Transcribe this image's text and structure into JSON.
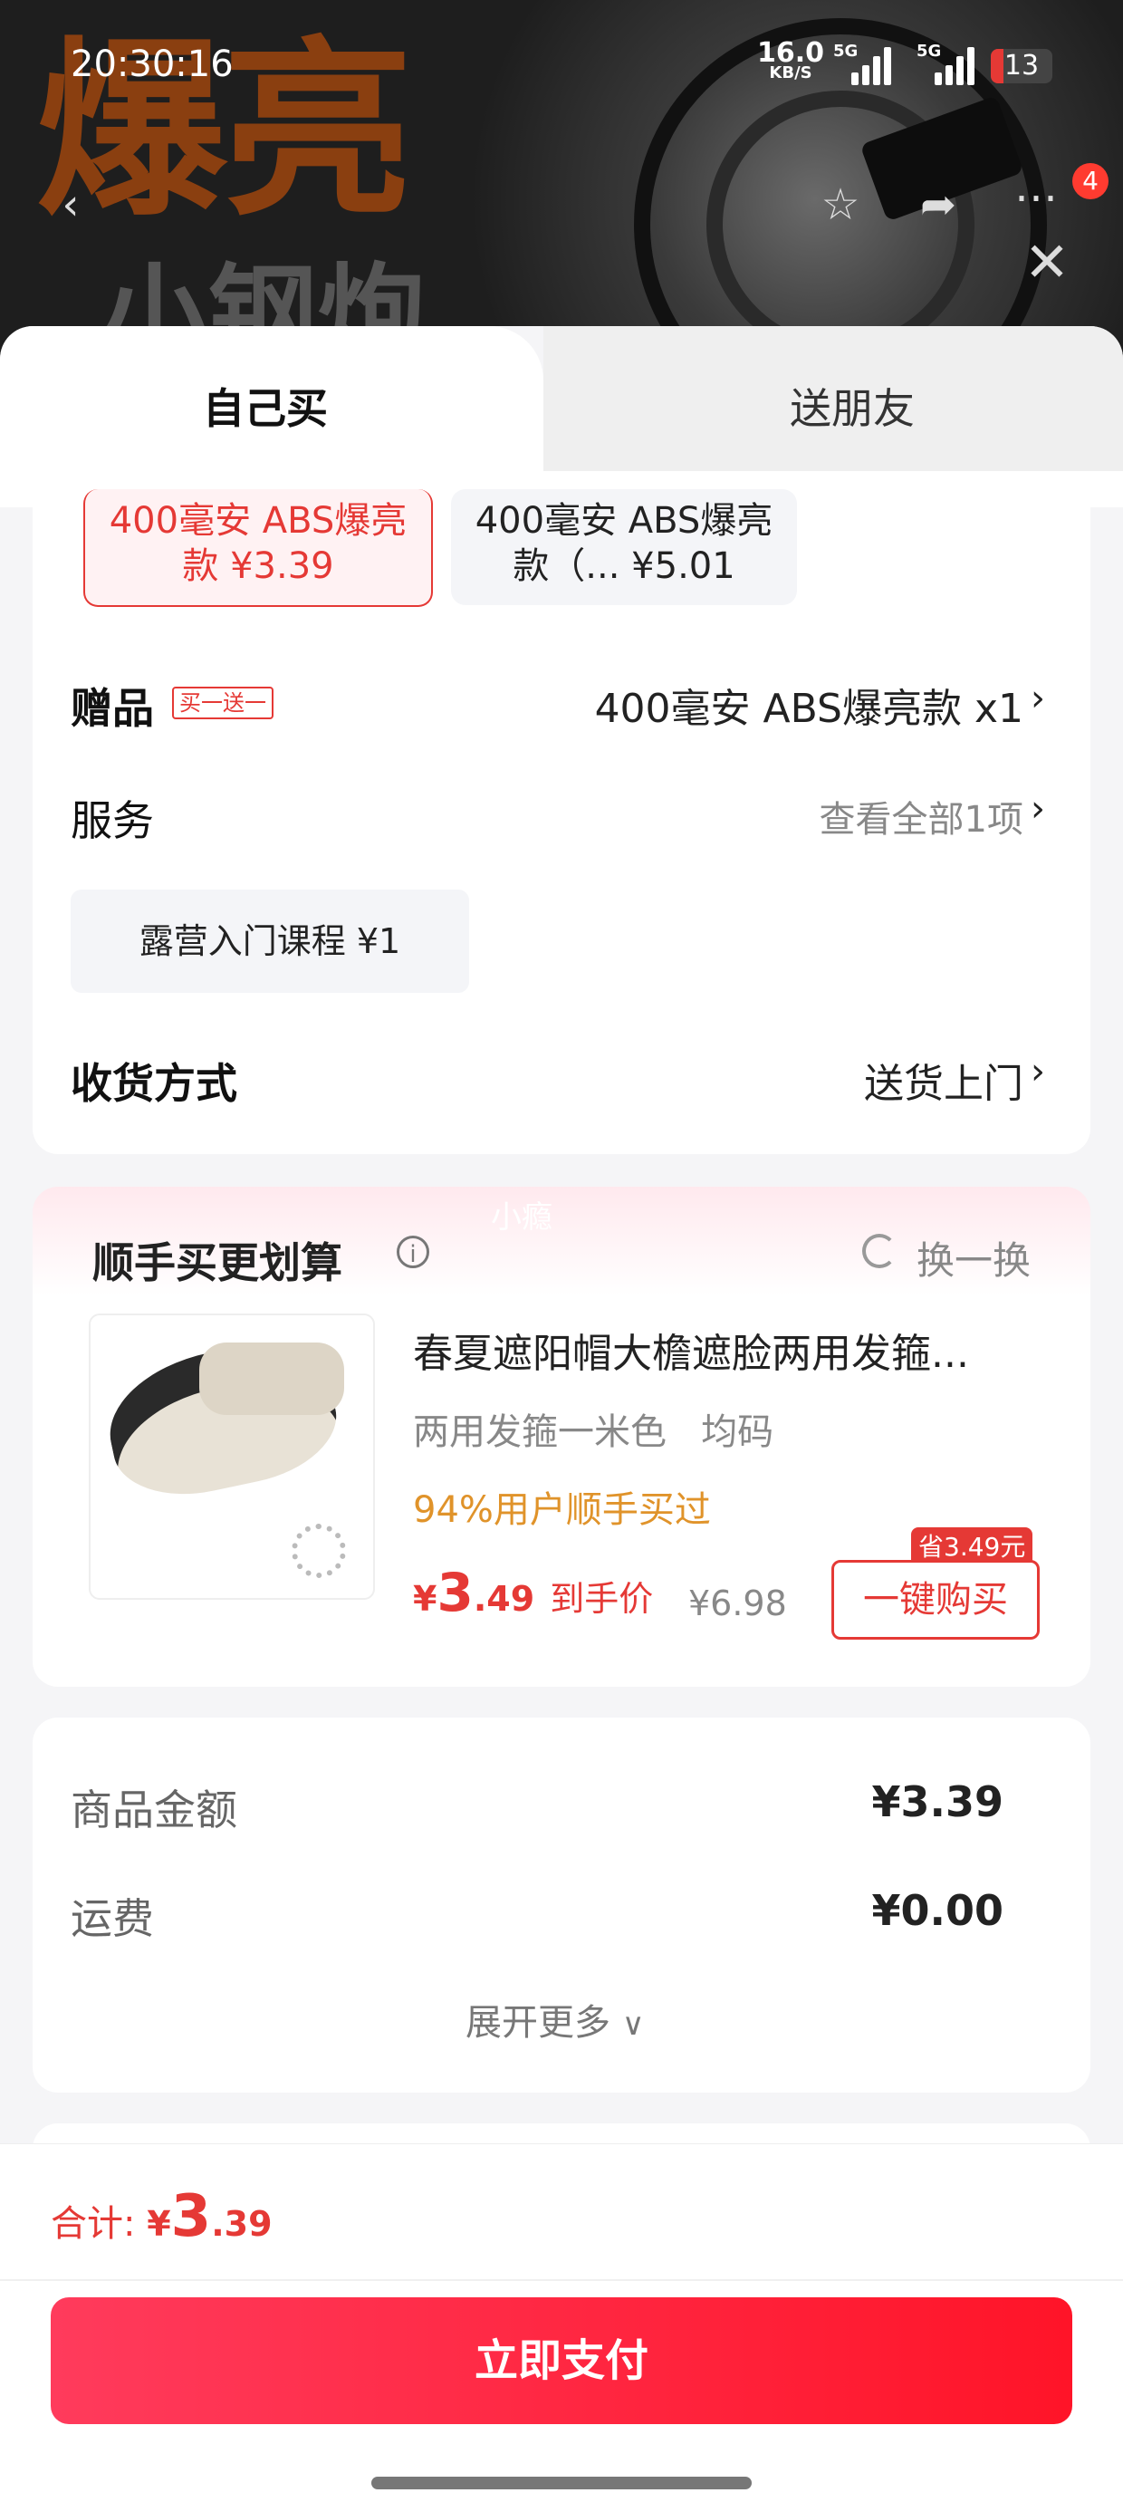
{
  "status_bar": {
    "time": "20:30:16",
    "net_speed_value": "16.0",
    "net_speed_unit": "KB/S",
    "signal1_label": "5G",
    "signal2_label": "5G",
    "battery": "13"
  },
  "header_bg": {
    "headline": "爆亮",
    "subline": "小钢炮",
    "cart_badge": "4"
  },
  "tabs": {
    "self_buy": "自己买",
    "gift_friend": "送朋友"
  },
  "options": [
    {
      "line1": "400毫安 ABS爆亮",
      "line2": "款 ¥3.39",
      "selected": true
    },
    {
      "line1": "400毫安 ABS爆亮",
      "line2": "款（... ¥5.01",
      "selected": false
    }
  ],
  "gift": {
    "label": "赠品",
    "tag": "买一送一",
    "value": "400毫安 ABS爆亮款 x1"
  },
  "service": {
    "label": "服务",
    "value": "查看全部1项",
    "item": "露营入门课程  ¥1"
  },
  "delivery": {
    "label": "收货方式",
    "value": "送货上门"
  },
  "addon": {
    "watermark": "小瘾",
    "title": "顺手买更划算",
    "refresh": "换一换",
    "product_title": "春夏遮阳帽大檐遮脸两用发箍...",
    "spec": "两用发箍一米色   均码",
    "stat": "94%用户顺手买过",
    "price_symbol": "¥",
    "price_int": "3",
    "price_dec": ".49",
    "price_tag": "到手价",
    "orig_price": "¥6.98",
    "save_badge": "省3.49元",
    "buy_button": "一键购买"
  },
  "summary": {
    "goods_label": "商品金额",
    "goods_value": "¥3.39",
    "ship_label": "运费",
    "ship_value": "¥0.00",
    "expand": "展开更多"
  },
  "footer": {
    "total_label": "合计: ",
    "total_symbol": "¥",
    "total_int": "3",
    "total_dec": ".39",
    "pay_button": "立即支付"
  }
}
